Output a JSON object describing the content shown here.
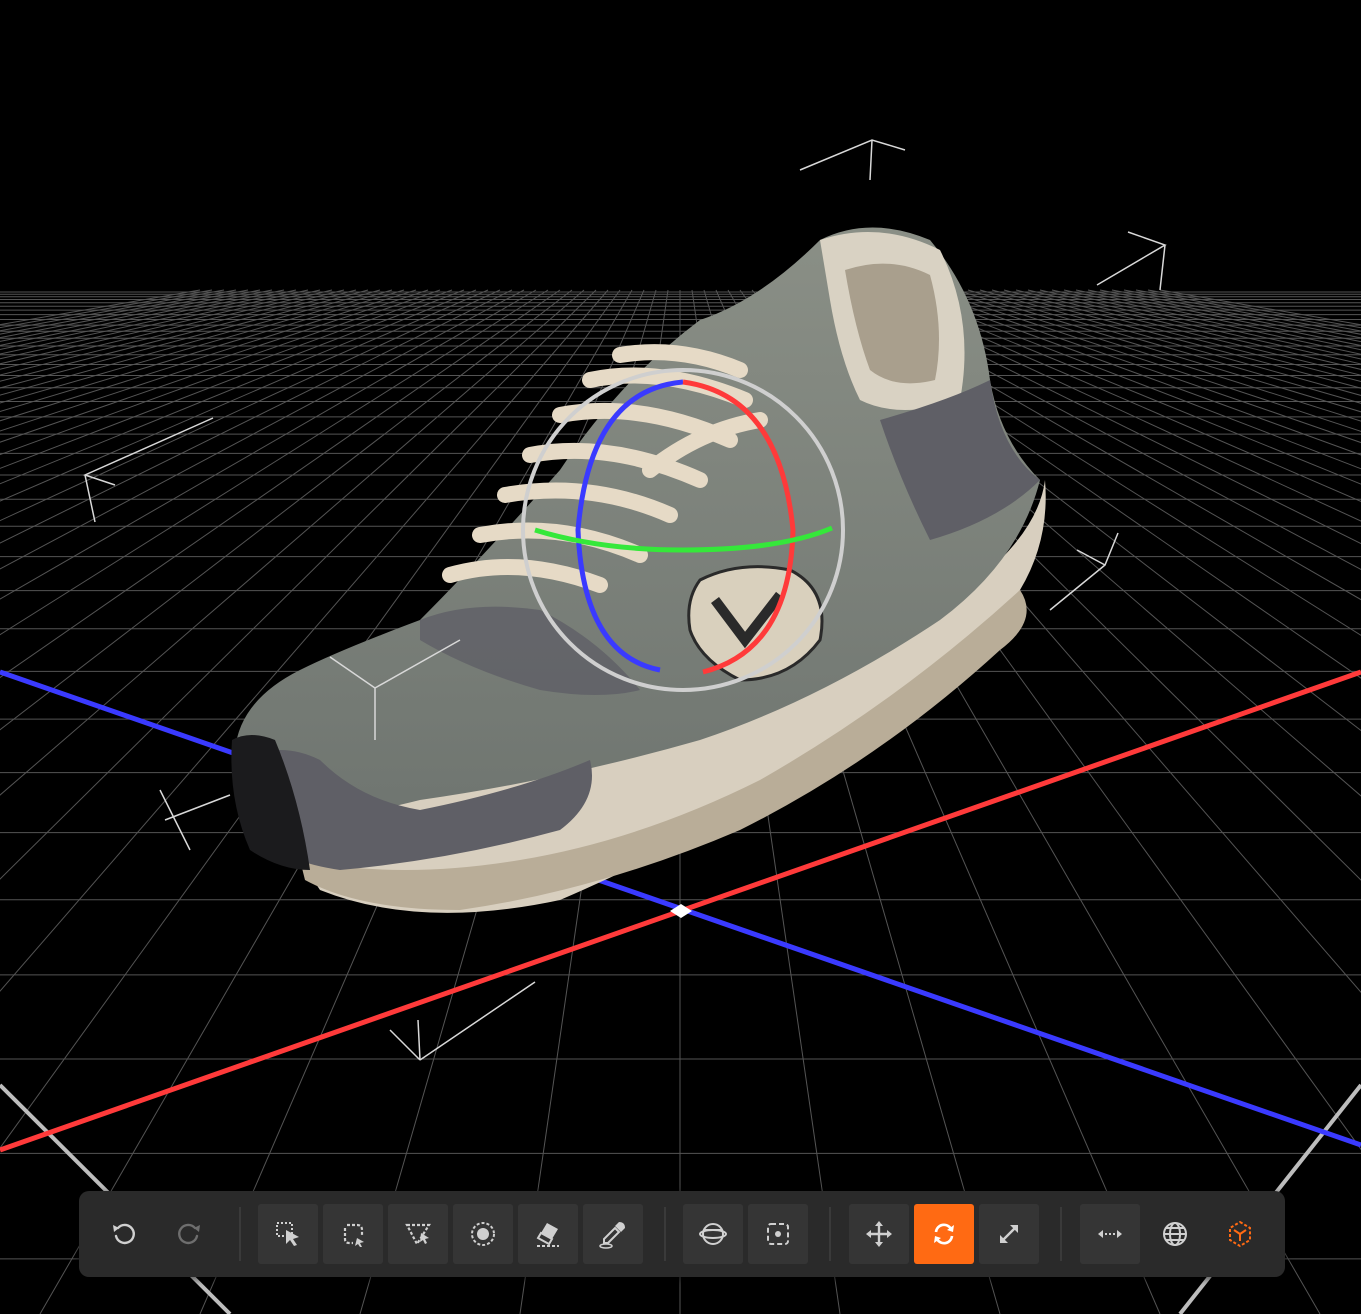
{
  "viewport": {
    "object": "sneaker-3d-model",
    "grid": true,
    "axes": {
      "x_axis_color": "#ff3a3a",
      "z_axis_color": "#3a3aff",
      "gizmo_y_color": "#35e83a"
    },
    "gizmo": "rotate"
  },
  "toolbar": {
    "accent_color": "#ff6a13",
    "groups": [
      {
        "name": "history",
        "tools": [
          {
            "id": "undo",
            "icon": "undo-icon",
            "enabled": true
          },
          {
            "id": "redo",
            "icon": "redo-icon",
            "enabled": false
          }
        ]
      },
      {
        "name": "selection",
        "tools": [
          {
            "id": "select",
            "icon": "box-select-icon"
          },
          {
            "id": "lasso",
            "icon": "lasso-select-icon"
          },
          {
            "id": "polygon",
            "icon": "polygon-select-icon"
          },
          {
            "id": "brush",
            "icon": "brush-select-icon"
          },
          {
            "id": "eraser",
            "icon": "eraser-icon"
          },
          {
            "id": "eyedropper",
            "icon": "eyedropper-icon"
          }
        ]
      },
      {
        "name": "view",
        "tools": [
          {
            "id": "sphere",
            "icon": "sphere-icon"
          },
          {
            "id": "frame",
            "icon": "frame-selection-icon"
          }
        ]
      },
      {
        "name": "transform",
        "active": "rotate",
        "tools": [
          {
            "id": "move",
            "icon": "move-icon"
          },
          {
            "id": "rotate",
            "icon": "rotate-icon"
          },
          {
            "id": "scale",
            "icon": "scale-icon"
          }
        ]
      },
      {
        "name": "space",
        "tools": [
          {
            "id": "measure",
            "icon": "measure-icon"
          },
          {
            "id": "world",
            "icon": "globe-icon"
          },
          {
            "id": "local",
            "icon": "local-space-icon"
          }
        ]
      }
    ]
  }
}
